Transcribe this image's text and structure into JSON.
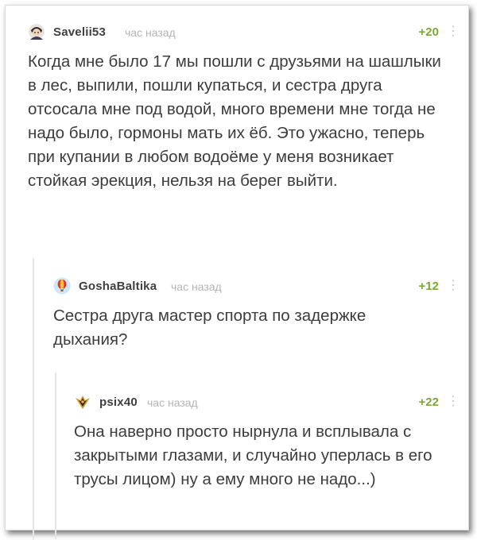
{
  "comments": [
    {
      "username": "Savelii53",
      "time": "час назад",
      "rating": "+20",
      "avatar_icon": "anime-character-avatar",
      "text": "Когда мне было 17 мы пошли с друзьями на шашлыки в лес, выпили, пошли купаться, и сестра друга отсосала мне под водой, много времени мне тогда не надо было, гормоны мать их ёб. Это ужасно, теперь при купании в любом водоёме у меня возникает стойкая эрекция, нельзя на берег выйти."
    },
    {
      "username": "GoshaBaltika",
      "time": "час назад",
      "rating": "+12",
      "avatar_icon": "hot-air-balloon-avatar",
      "text": "Сестра друга мастер спорта по задержке дыхания?"
    },
    {
      "username": "psix40",
      "time": "час назад",
      "rating": "+22",
      "avatar_icon": "winged-emblem-avatar",
      "text": "Она наверно просто нырнула и всплывала с закрытыми глазами, и случайно уперлась в его трусы лицом) ну а ему много не надо...)"
    }
  ],
  "colors": {
    "rating": "#7aa83a",
    "time": "#b4b4b4",
    "text": "#3c3c3c",
    "username": "#3f3f3f"
  },
  "more_icon": "vertical-dots-icon"
}
